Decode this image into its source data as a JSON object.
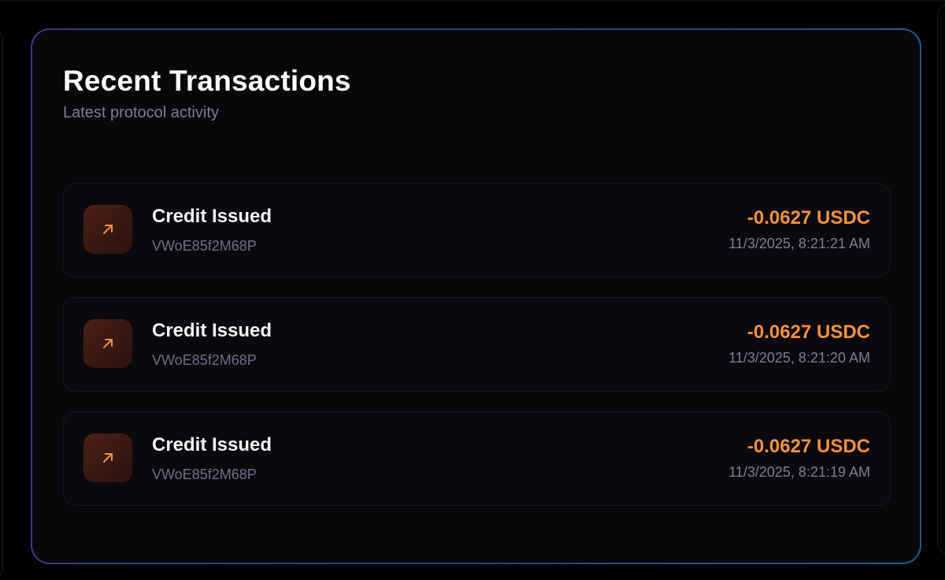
{
  "card": {
    "title": "Recent Transactions",
    "subtitle": "Latest protocol activity"
  },
  "transactions": [
    {
      "icon": "arrow-up-right-icon",
      "title": "Credit Issued",
      "id": "VWoE85f2M68P",
      "amount": "-0.0627 USDC",
      "time": "11/3/2025, 8:21:21 AM"
    },
    {
      "icon": "arrow-up-right-icon",
      "title": "Credit Issued",
      "id": "VWoE85f2M68P",
      "amount": "-0.0627 USDC",
      "time": "11/3/2025, 8:21:20 AM"
    },
    {
      "icon": "arrow-up-right-icon",
      "title": "Credit Issued",
      "id": "VWoE85f2M68P",
      "amount": "-0.0627 USDC",
      "time": "11/3/2025, 8:21:19 AM"
    }
  ],
  "colors": {
    "accent_amount": "#f2913f",
    "border_gradient_start": "#3c3986",
    "border_gradient_end": "#1f5a86",
    "card_background": "#08080b"
  }
}
